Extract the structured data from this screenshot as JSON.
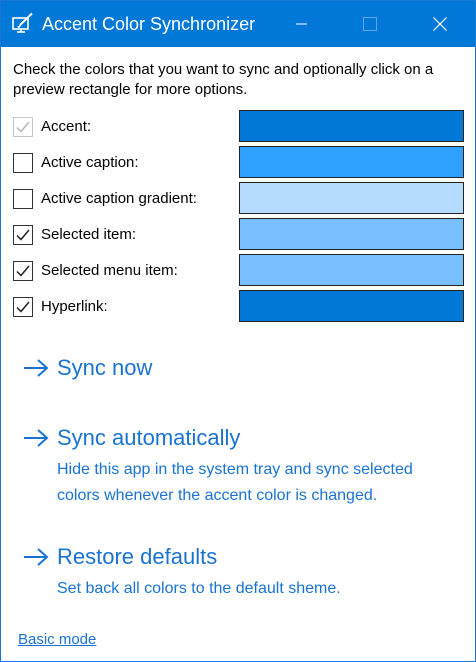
{
  "window": {
    "title": "Accent Color Synchronizer",
    "icon": "palette-brush-icon",
    "controls": [
      "minimize-icon",
      "maximize-icon",
      "close-icon"
    ]
  },
  "intro_text": "Check the colors that you want to sync and optionally click on a preview rectangle for more options.",
  "colors": [
    {
      "label": "Accent:",
      "checked": true,
      "disabled": true,
      "color": "#0078d7"
    },
    {
      "label": "Active caption:",
      "checked": false,
      "disabled": false,
      "color": "#2ea1ff"
    },
    {
      "label": "Active caption gradient:",
      "checked": false,
      "disabled": false,
      "color": "#b5dcff"
    },
    {
      "label": "Selected item:",
      "checked": true,
      "disabled": false,
      "color": "#78bfff"
    },
    {
      "label": "Selected menu item:",
      "checked": true,
      "disabled": false,
      "color": "#78bfff"
    },
    {
      "label": "Hyperlink:",
      "checked": true,
      "disabled": false,
      "color": "#0078d7"
    }
  ],
  "actions": [
    {
      "title": "Sync now",
      "description": ""
    },
    {
      "title": "Sync automatically",
      "description": "Hide this app in the system tray and sync selected colors whenever the accent color is changed."
    },
    {
      "title": "Restore defaults",
      "description": "Set back all colors to the default sheme."
    }
  ],
  "basic_mode_link": "Basic mode",
  "theme": {
    "titlebar": "#0078d7",
    "link": "#1a73d2"
  }
}
